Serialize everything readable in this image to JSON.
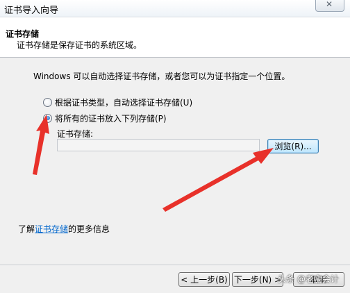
{
  "window": {
    "title": "证书导入向导"
  },
  "header": {
    "title": "证书存储",
    "description": "证书存储是保存证书的系统区域。"
  },
  "body": {
    "intro": "Windows 可以自动选择证书存储，或者您可以为证书指定一个位置。",
    "options": [
      {
        "label": "根据证书类型，自动选择证书存储(U)",
        "checked": false
      },
      {
        "label": "将所有的证书放入下列存储(P)",
        "checked": true
      }
    ],
    "store_label": "证书存储:",
    "store_value": "",
    "browse_label": "浏览(R)..."
  },
  "link_line": {
    "prefix": "了解",
    "link": "证书存储",
    "suffix": "的更多信息"
  },
  "footer": {
    "back_label": "< 上一步(B)",
    "next_label": "下一步(N) >",
    "cancel_label": "取消"
  },
  "watermark": "头条 @老宝会计",
  "colors": {
    "annotation_arrow": "#e8312a",
    "link": "#0066cc"
  }
}
